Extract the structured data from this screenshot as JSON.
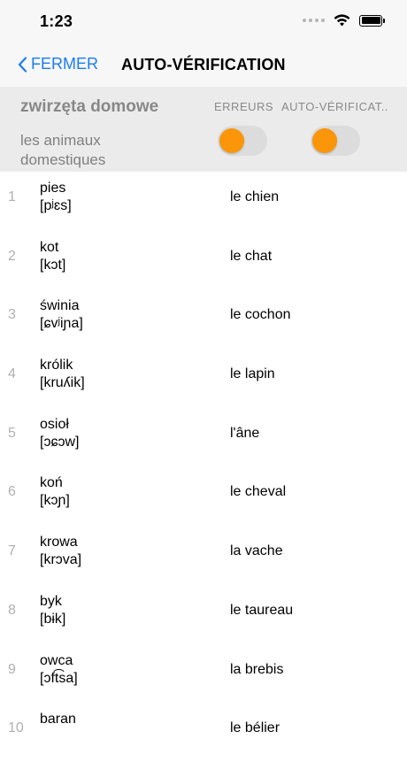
{
  "status": {
    "time": "1:23"
  },
  "nav": {
    "back_label": "FERMER",
    "title": "AUTO-VÉRIFICATION"
  },
  "header": {
    "polish_title": "zwirzęta domowe",
    "french_title": "les animaux domestiques",
    "col_errors": "ERREURS",
    "col_auto": "AUTO-VÉRIFICAT...",
    "toggle_color": "#fb9509"
  },
  "words": [
    {
      "num": "1",
      "word": "pies",
      "phon": "[pʲɛs]",
      "trans": "le chien"
    },
    {
      "num": "2",
      "word": "kot",
      "phon": "[kɔt]",
      "trans": "le chat"
    },
    {
      "num": "3",
      "word": "świnia",
      "phon": "[ɕvʲiɲa]",
      "trans": "le cochon"
    },
    {
      "num": "4",
      "word": "królik",
      "phon": "[kruʎik]",
      "trans": "le lapin"
    },
    {
      "num": "5",
      "word": "osioł",
      "phon": "[ɔɕɔw]",
      "trans": "l'âne"
    },
    {
      "num": "6",
      "word": "koń",
      "phon": "[kɔɲ]",
      "trans": "le cheval"
    },
    {
      "num": "7",
      "word": "krowa",
      "phon": "[krɔva]",
      "trans": "la vache"
    },
    {
      "num": "8",
      "word": "byk",
      "phon": "[bɨk]",
      "trans": "le taureau"
    },
    {
      "num": "9",
      "word": "owca",
      "phon": "[ɔft͡sa]",
      "trans": "la brebis"
    },
    {
      "num": "10",
      "word": "baran",
      "phon": "",
      "trans": "le bélier"
    }
  ]
}
